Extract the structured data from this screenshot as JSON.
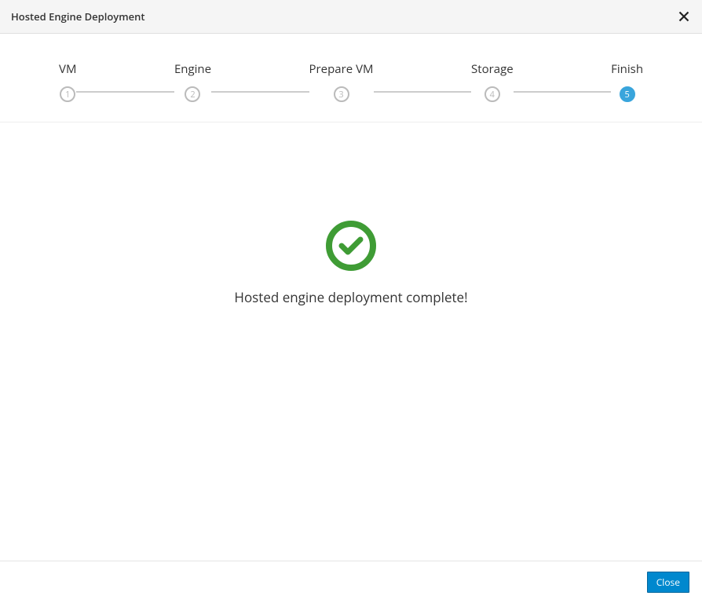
{
  "header": {
    "title": "Hosted Engine Deployment"
  },
  "steps": [
    {
      "num": "1",
      "label": "VM",
      "active": false
    },
    {
      "num": "2",
      "label": "Engine",
      "active": false
    },
    {
      "num": "3",
      "label": "Prepare VM",
      "active": false
    },
    {
      "num": "4",
      "label": "Storage",
      "active": false
    },
    {
      "num": "5",
      "label": "Finish",
      "active": true
    }
  ],
  "content": {
    "success_message": "Hosted engine deployment complete!"
  },
  "footer": {
    "close_label": "Close"
  },
  "colors": {
    "success_green": "#3f9c35",
    "active_blue": "#39a5dc",
    "button_blue": "#0088ce"
  }
}
